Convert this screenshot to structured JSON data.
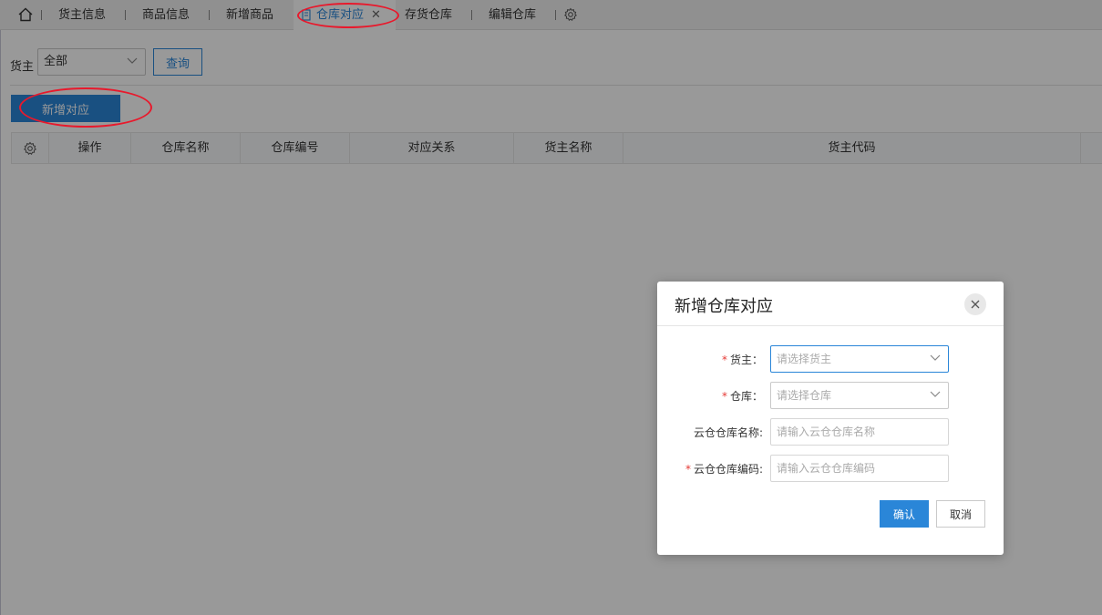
{
  "tabs": {
    "items": [
      {
        "label": "货主信息"
      },
      {
        "label": "商品信息"
      },
      {
        "label": "新增商品"
      },
      {
        "label": "仓库对应",
        "close": "✕"
      },
      {
        "label": "存货仓库"
      },
      {
        "label": "编辑仓库"
      }
    ]
  },
  "filter": {
    "owner_label": "货主",
    "owner_value": "全部",
    "query_label": "查询"
  },
  "toolbar": {
    "add_label": "新增对应"
  },
  "grid": {
    "columns": [
      "操作",
      "仓库名称",
      "仓库编号",
      "对应关系",
      "货主名称",
      "货主代码"
    ]
  },
  "dialog": {
    "title": "新增仓库对应",
    "fields": [
      {
        "label": "货主：",
        "placeholder": "请选择货主",
        "required": true
      },
      {
        "label": "仓库：",
        "placeholder": "请选择仓库",
        "required": true
      },
      {
        "label": "云仓仓库名称:",
        "placeholder": "请输入云仓仓库名称",
        "required": false
      },
      {
        "label": "云仓仓库编码:",
        "placeholder": "请输入云仓仓库编码",
        "required": true
      }
    ],
    "required_mark": "*",
    "confirm_label": "确认",
    "cancel_label": "取消"
  },
  "colors": {
    "accent": "#2a86d8",
    "annotation": "#e8192c"
  },
  "icons": [
    "home-icon",
    "document-icon",
    "close-icon",
    "gear-icon",
    "chevron-down-icon"
  ]
}
